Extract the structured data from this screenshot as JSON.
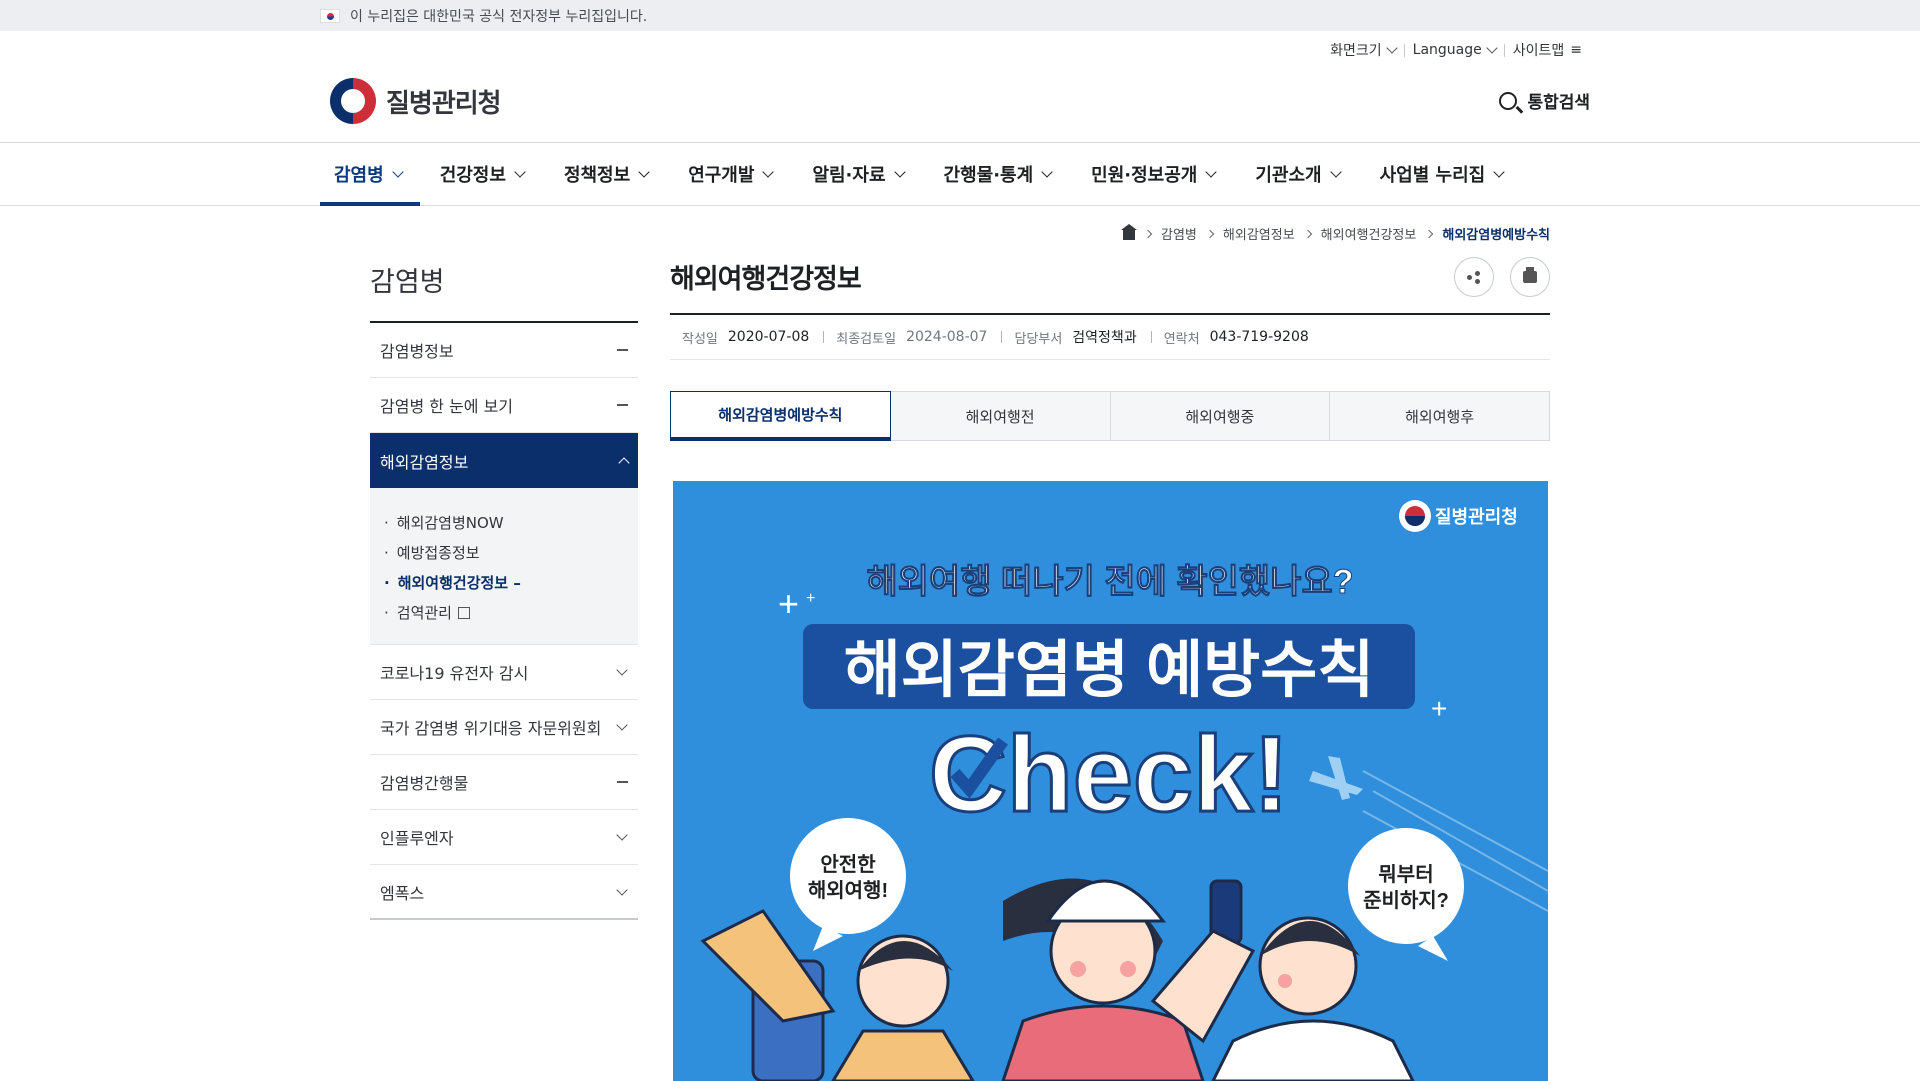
{
  "notice": {
    "text": "이 누리집은 대한민국 공식 전자정부 누리집입니다."
  },
  "utility": {
    "font_size": "화면크기",
    "language": "Language",
    "sitemap": "사이트맵"
  },
  "logo": {
    "name": "질병관리청"
  },
  "search": {
    "label": "통합검색"
  },
  "gnb": {
    "items": [
      "감염병",
      "건강정보",
      "정책정보",
      "연구개발",
      "알림·자료",
      "간행물·통계",
      "민원·정보공개",
      "기관소개",
      "사업별 누리집"
    ]
  },
  "lnb": {
    "title": "감염병",
    "items": [
      "감염병정보",
      "감염병 한 눈에 보기",
      "해외감염정보",
      "코로나19 유전자 감시",
      "국가 감염병 위기대응 자문위원회",
      "감염병간행물",
      "인플루엔자",
      "엠폭스"
    ],
    "sub": [
      "해외감염병NOW",
      "예방접종정보",
      "해외여행건강정보 –",
      "검역관리"
    ]
  },
  "breadcrumb": [
    "감염병",
    "해외감염정보",
    "해외여행건강정보",
    "해외감염병예방수칙"
  ],
  "page": {
    "title": "해외여행건강정보"
  },
  "meta": {
    "created_label": "작성일",
    "created": "2020-07-08",
    "reviewed_label": "최종검토일",
    "reviewed": "2024-08-07",
    "dept_label": "담당부서",
    "dept": "검역정책과",
    "contact_label": "연락처",
    "contact": "043-719-9208"
  },
  "tabs": [
    "해외감염병예방수칙",
    "해외여행전",
    "해외여행중",
    "해외여행후"
  ],
  "banner": {
    "logo": "질병관리청",
    "question": "해외여행 떠나기 전에 확인했나요?",
    "headline": "해외감염병 예방수칙",
    "check": "Check!",
    "bubble_left": [
      "안전한",
      "해외여행!"
    ],
    "bubble_right": [
      "뭐부터",
      "준비하지?"
    ]
  },
  "colors": {
    "primary": "#0b2f6a",
    "banner_bg": "#2f8fdc"
  }
}
